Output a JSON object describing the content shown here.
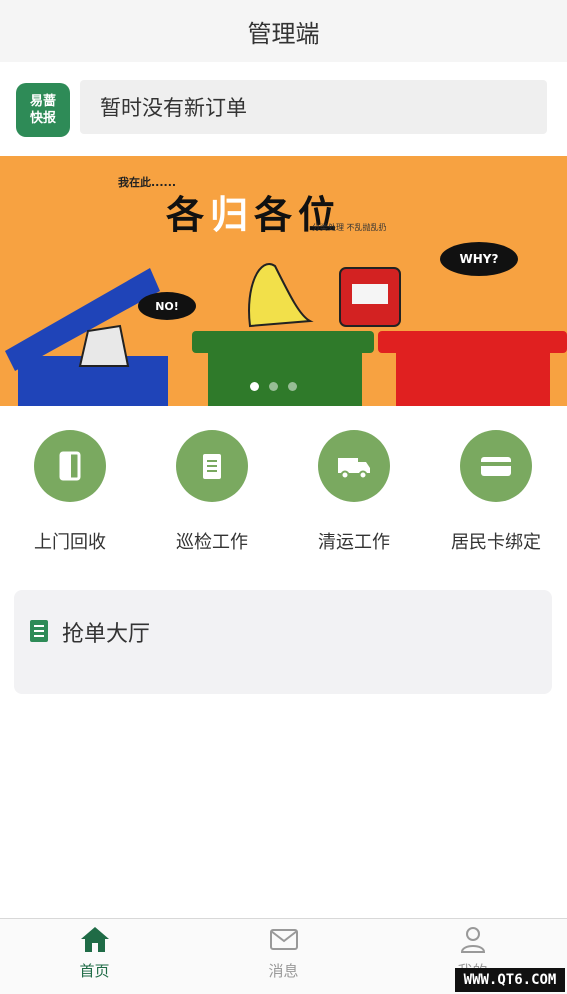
{
  "header": {
    "title": "管理端"
  },
  "notice": {
    "logo_line1": "易蔷",
    "logo_line2": "快报",
    "text": "暂时没有新订单"
  },
  "banner": {
    "subtitle": "我在此......",
    "headline_part1": "各",
    "headline_accent": "归",
    "headline_part2": "各位",
    "tagline": "分类处理  不乱抛乱扔",
    "bubble_no": "NO!",
    "bubble_why": "WHY?",
    "dots": 3,
    "active_dot": 0,
    "bin_colors": [
      "#1f44b8",
      "#2f7a2a",
      "#e02020"
    ]
  },
  "menu": {
    "items": [
      {
        "label": "上门回收",
        "icon": "door-icon"
      },
      {
        "label": "巡检工作",
        "icon": "clipboard-icon"
      },
      {
        "label": "清运工作",
        "icon": "truck-icon"
      },
      {
        "label": "居民卡绑定",
        "icon": "card-icon"
      }
    ]
  },
  "hall": {
    "title": "抢单大厅",
    "icon": "document-icon"
  },
  "tabbar": {
    "tabs": [
      {
        "label": "首页",
        "icon": "home-icon",
        "active": true
      },
      {
        "label": "消息",
        "icon": "mail-icon",
        "active": false
      },
      {
        "label": "我的",
        "icon": "user-icon",
        "active": false
      }
    ]
  },
  "watermark": "WWW.QT6.COM",
  "colors": {
    "accent_green": "#2e8b57",
    "menu_circle": "#7aa960",
    "banner_bg": "#f7a241",
    "active_tab": "#1f6b46"
  }
}
